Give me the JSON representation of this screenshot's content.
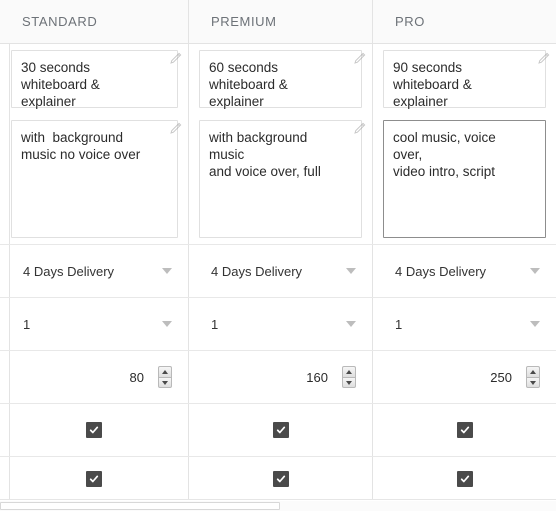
{
  "packages": [
    {
      "name": "STANDARD",
      "title": "30 seconds\nwhiteboard & explainer",
      "description": "with  background\nmusic no voice over",
      "description_focused": false,
      "delivery": "4 Days Delivery",
      "revisions": "1",
      "price": "80",
      "extras_checked": [
        true,
        true
      ]
    },
    {
      "name": "PREMIUM",
      "title": "60 seconds\nwhiteboard & explainer",
      "description": "with background music\nand voice over, full",
      "description_focused": false,
      "delivery": "4 Days Delivery",
      "revisions": "1",
      "price": "160",
      "extras_checked": [
        true,
        true
      ]
    },
    {
      "name": "PRO",
      "title": "90 seconds\nwhiteboard & explainer",
      "description": "cool music, voice over,\nvideo intro, script",
      "description_focused": true,
      "delivery": "4 Days Delivery",
      "revisions": "1",
      "price": "250",
      "extras_checked": [
        true,
        true
      ]
    }
  ],
  "icons": {
    "edit": "pencil-icon",
    "dropdown": "chevron-down-icon",
    "spinner_up": "spinner-up-icon",
    "spinner_down": "spinner-down-icon",
    "check": "check-icon"
  },
  "colors": {
    "header_bg": "#fafafa",
    "header_text": "#6d7278",
    "border": "#e3e3e3",
    "text": "#2b2b2b",
    "checkbox_fill": "#4a4a4a",
    "caret": "#bdbdbd",
    "focus_border": "#8d8d8d"
  },
  "scrollbar": {
    "orientation": "horizontal",
    "thumb_width_px": "280",
    "thumb_left_px": "0"
  }
}
